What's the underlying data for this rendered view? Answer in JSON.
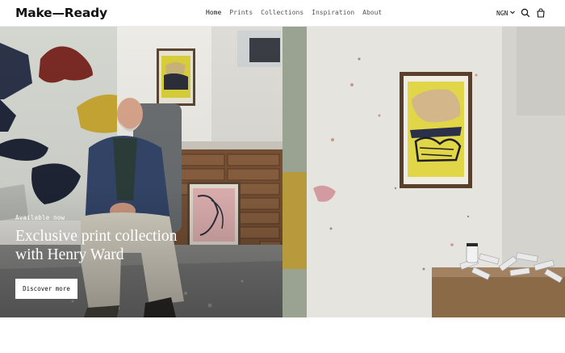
{
  "brand": {
    "logo": "Make—Ready"
  },
  "nav": {
    "items": [
      {
        "label": "Home",
        "active": true
      },
      {
        "label": "Prints",
        "active": false
      },
      {
        "label": "Collections",
        "active": false
      },
      {
        "label": "Inspiration",
        "active": false
      },
      {
        "label": "About",
        "active": false
      }
    ]
  },
  "header": {
    "currency": "NGN",
    "icons": [
      "chevron-down-icon",
      "search-icon",
      "cart-icon"
    ]
  },
  "hero": {
    "eyebrow": "Available now",
    "headline": "Exclusive print collection with Henry Ward",
    "cta_label": "Discover more"
  },
  "colors": {
    "text": "#111111",
    "nav_text": "#555555",
    "cta_bg": "#ffffff",
    "overlay_text": "#ffffff"
  }
}
